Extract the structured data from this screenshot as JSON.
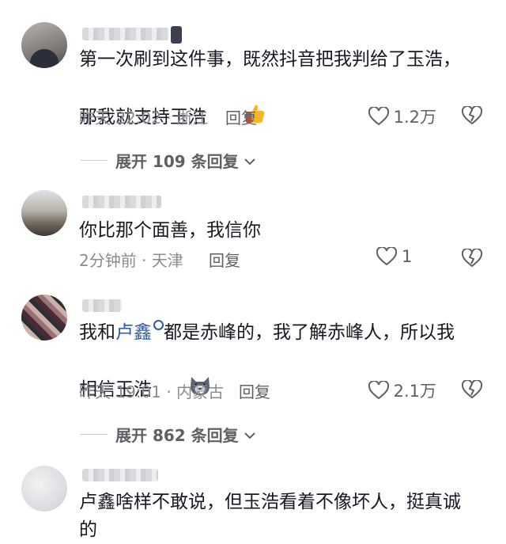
{
  "comments": [
    {
      "text": "第一次刷到这件事，既然抖音把我判给了玉浩，\n那我就支持玉浩",
      "time_location": "昨天 22:02 · 浙江",
      "reply_label": "回复",
      "likes": "1.2万",
      "emoji": "thumbs-up-icon",
      "expand_label": "展开 109 条回复"
    },
    {
      "text": "你比那个面善，我信你",
      "time_location": "2分钟前 · 天津",
      "reply_label": "回复",
      "likes": "1"
    },
    {
      "text_before": "我和",
      "mention": "卢鑫",
      "text_after": "都是赤峰的，我了解赤峰人，所以我\n相信玉浩",
      "time_location": "昨天 19:01 · 内蒙古",
      "reply_label": "回复",
      "likes": "2.1万",
      "emoji": "husky-dog-icon",
      "expand_label": "展开 862 条回复"
    },
    {
      "text": "卢鑫啥样不敢说，但玉浩看着不像坏人，挺真诚\n的"
    }
  ]
}
